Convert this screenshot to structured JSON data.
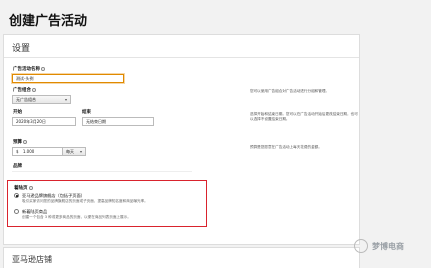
{
  "page_title": "创建广告活动",
  "settings": {
    "header": "设置",
    "campaign_name": {
      "label": "广告活动名称",
      "value": "测试-头例"
    },
    "portfolio": {
      "label": "广告组合",
      "value": "无广告组合"
    },
    "start": {
      "label": "开始",
      "value": "2020年3月20日"
    },
    "end": {
      "label": "结束",
      "value": "无结束日期"
    },
    "budget": {
      "label": "预算",
      "currency": "$",
      "value": "1.000",
      "period": "每天"
    },
    "help_portfolio": "您可以使用广告组合对广告活动进行分组和管理。",
    "help_dates": "选择开始和结束日期。您可以在广告活动开始后更改结束日期，也可以选择不设置结束日期。",
    "help_budget": "预算是您愿意在广告活动上每天花费的金额。",
    "creative_label": "品牌",
    "ad_format_label": "着陆页",
    "option1": {
      "title": "亚马逊品牌旗舰店（包括子页面）",
      "desc": "吸引买家访问您的品牌旗舰店的页面或子页面，提高品牌知名度和商品曝光率。"
    },
    "option2": {
      "title": "新着陆页商品",
      "desc": "创建一个包含 3 种或更多商品的页面，以便在商品列表页面上展示。"
    }
  },
  "section2": {
    "title": "亚马逊店铺"
  },
  "watermark": {
    "text": "梦博电商"
  },
  "colors": {
    "highlight": "#d9232d",
    "focus": "#e08a00"
  }
}
